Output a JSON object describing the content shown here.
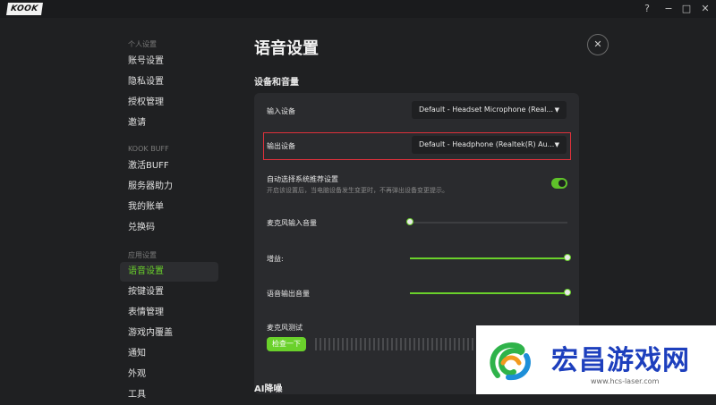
{
  "app": {
    "logo_text": "KOOK"
  },
  "window_controls": {
    "help": "?",
    "minimize": "−",
    "maximize": "□",
    "close": "✕"
  },
  "sidebar": {
    "sections": [
      {
        "title": "个人设置",
        "items": [
          "账号设置",
          "隐私设置",
          "授权管理",
          "邀请"
        ]
      },
      {
        "title": "KOOK BUFF",
        "items": [
          "激活BUFF",
          "服务器助力",
          "我的账单",
          "兑换码"
        ]
      },
      {
        "title": "应用设置",
        "items": [
          "语音设置",
          "按键设置",
          "表情管理",
          "游戏内覆盖",
          "通知",
          "外观",
          "工具"
        ]
      }
    ],
    "active_item": "语音设置"
  },
  "page": {
    "title": "语音设置",
    "close_icon": "✕",
    "group_devices": "设备和音量",
    "input_device_label": "输入设备",
    "input_device_value": "Default - Headset Microphone (Real...",
    "output_device_label": "输出设备",
    "output_device_value": "Default - Headphone (Realtek(R) Au...",
    "auto_select_label": "自动选择系统推荐设置",
    "auto_select_desc": "开启该设置后，当电脑设备发生变更时，不再弹出设备变更提示。",
    "auto_select_on": true,
    "mic_volume_label": "麦克风输入音量",
    "mic_volume_level": 0,
    "gain_label": "增益:",
    "gain_level": 1,
    "output_volume_label": "语音输出音量",
    "output_volume_level": 1,
    "mic_test_label": "麦克风测试",
    "mic_test_button": "检查一下",
    "group_ai": "AI降噪"
  },
  "watermark": {
    "text": "宏昌游戏网",
    "url": "www.hcs-laser.com"
  },
  "colors": {
    "accent": "#6ad12b",
    "background": "#1f2022",
    "card": "#2a2b2e",
    "highlight_border": "#e0313b",
    "watermark_text": "#1d3fbd"
  },
  "icons": [
    "help-icon",
    "minimize-icon",
    "maximize-icon",
    "close-icon",
    "caret-down-icon"
  ]
}
